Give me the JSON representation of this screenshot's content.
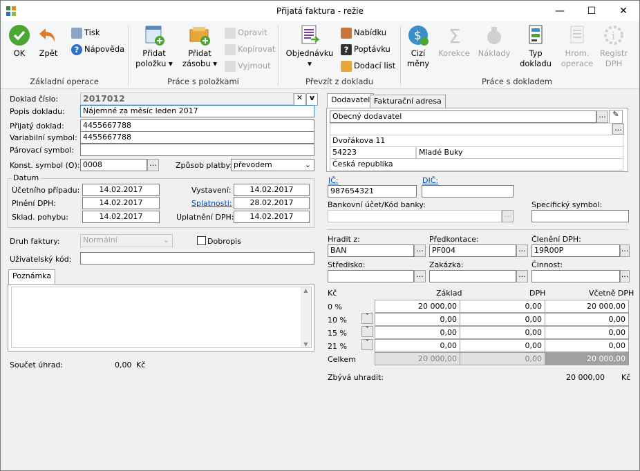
{
  "window": {
    "title": "Přijatá faktura - režie",
    "min": "—",
    "max": "☐",
    "close": "✕"
  },
  "ribbon": {
    "ok": "OK",
    "back": "Zpět",
    "print": "Tisk",
    "help": "Nápověda",
    "grp1": "Základní operace",
    "add_item": [
      "Přidat",
      "položku ▾"
    ],
    "add_stock": [
      "Přidat",
      "zásobu ▾"
    ],
    "edit": "Opravit",
    "copy": "Kopírovat",
    "cut": "Vyjmout",
    "grp2": "Práce s položkami",
    "order": [
      "Objednávku",
      "▾"
    ],
    "offer": "Nabídku",
    "inquiry": "Poptávku",
    "delivery": "Dodací list",
    "grp3": "Převzít z dokladu",
    "foreign": [
      "Cizí",
      "měny"
    ],
    "correction": "Korekce",
    "costs": "Náklady",
    "doctype": [
      "Typ",
      "dokladu"
    ],
    "bulk": [
      "Hrom.",
      "operace"
    ],
    "vat_reg": [
      "Registr",
      "DPH"
    ],
    "grp4": "Práce s dokladem"
  },
  "form": {
    "doc_no_label": "Doklad číslo:",
    "doc_no": "2017012",
    "desc_label": "Popis dokladu:",
    "desc": "Nájemné za měsíc  leden 2017",
    "recv_label": "Přijatý doklad:",
    "recv": "4455667788",
    "var_label": "Variabilní symbol:",
    "var": "4455667788",
    "pair_label": "Párovací symbol:",
    "pair": "",
    "const_label": "Konst. symbol (O):",
    "const": "0008",
    "pay_label": "Způsob platby:",
    "pay": "převodem",
    "datum": "Datum",
    "d1_label": "Účetního případu:",
    "d1": "14.02.2017",
    "d2_label": "Plnění DPH:",
    "d2": "14.02.2017",
    "d3_label": "Sklad. pohybu:",
    "d3": "14.02.2017",
    "d4_label": "Vystavení:",
    "d4": "14.02.2017",
    "d5_label": "Splatnosti:",
    "d5": "28.02.2017",
    "d6_label": "Uplatnění DPH:",
    "d6": "14.02.2017",
    "kind_label": "Druh faktury:",
    "kind": "Normální",
    "dobropis": "Dobropis",
    "user_label": "Uživatelský kód:",
    "user": "",
    "note_tab": "Poznámka",
    "sum_label": "Součet úhrad:",
    "sum": "0,00",
    "sum_cur": "Kč"
  },
  "supplier": {
    "tab1": "Dodavatel",
    "tab2": "Fakturační adresa",
    "name": "Obecný dodavatel",
    "line2": "",
    "street": "Dvořákova 11",
    "zip": "54223",
    "city": "Mladé Buky",
    "country": "Česká republika",
    "ic_label": "IČ:",
    "ic": "987654321",
    "dic_label": "DIČ:",
    "dic": "",
    "bank_label": "Bankovní účet/Kód banky:",
    "bank": "",
    "spec_label": "Specifický symbol:",
    "spec": "",
    "pay_from_label": "Hradit z:",
    "pay_from": "BAN",
    "precont_label": "Předkontace:",
    "precont": "PF004",
    "vat_label": "Členění DPH:",
    "vat": "19Ř00P",
    "center_label": "Středisko:",
    "center": "",
    "order_label": "Zakázka:",
    "order": "",
    "act_label": "Činnost:",
    "act": ""
  },
  "vat_table": {
    "h_cur": "Kč",
    "h_base": "Základ",
    "h_vat": "DPH",
    "h_total": "Včetně DPH",
    "rows": [
      {
        "rate": "0 %",
        "base": "20 000,00",
        "vat": "0,00",
        "total": "20 000,00"
      },
      {
        "rate": "10 %",
        "base": "0,00",
        "vat": "0,00",
        "total": "0,00"
      },
      {
        "rate": "15 %",
        "base": "0,00",
        "vat": "0,00",
        "total": "0,00"
      },
      {
        "rate": "21 %",
        "base": "0,00",
        "vat": "0,00",
        "total": "0,00"
      }
    ],
    "tot_label": "Celkem",
    "tot_base": "20 000,00",
    "tot_vat": "0,00",
    "tot_total": "20 000,00",
    "remain_label": "Zbývá uhradit:",
    "remain": "20 000,00",
    "remain_cur": "Kč"
  }
}
